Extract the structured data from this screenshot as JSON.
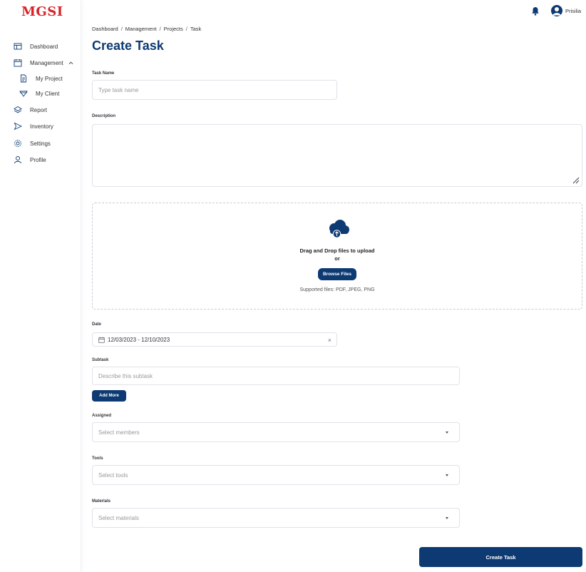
{
  "brand": {
    "logo_text": "MGSI",
    "logo_color": "#d8232a",
    "accent": "#0d3a72"
  },
  "header": {
    "user_name": "Prisilia"
  },
  "sidebar": {
    "items": [
      {
        "label": "Dashboard",
        "icon": "layout-icon"
      },
      {
        "label": "Management",
        "icon": "calendar-icon"
      },
      {
        "label": "My Project",
        "icon": "document-icon"
      },
      {
        "label": "My Client",
        "icon": "diamond-icon"
      },
      {
        "label": "Report",
        "icon": "layers-icon"
      },
      {
        "label": "Inventory",
        "icon": "send-icon"
      },
      {
        "label": "Settings",
        "icon": "gear-icon"
      },
      {
        "label": "Profile",
        "icon": "user-icon"
      }
    ]
  },
  "breadcrumb": [
    "Dashboard",
    "Management",
    "Projects",
    "Task"
  ],
  "page_title": "Create Task",
  "form": {
    "task_name": {
      "label": "Task Name",
      "placeholder": "Type task name"
    },
    "description": {
      "label": "Description"
    },
    "upload": {
      "title": "Drag and Drop files to upload",
      "or": "or",
      "browse_label": "Browse Files",
      "supported": "Supported files: PDF, JPEG, PNG"
    },
    "date": {
      "label": "Date",
      "value": "12/03/2023 - 12/10/2023",
      "clear": "×"
    },
    "subtask": {
      "label": "Subtask",
      "placeholder": "Describe this subtask",
      "add_more_label": "Add More"
    },
    "assigned": {
      "label": "Assigned",
      "placeholder": "Select members"
    },
    "tools": {
      "label": "Tools",
      "placeholder": "Select tools"
    },
    "materials": {
      "label": "Materials",
      "placeholder": "Select materials"
    },
    "submit_label": "Create Task"
  }
}
